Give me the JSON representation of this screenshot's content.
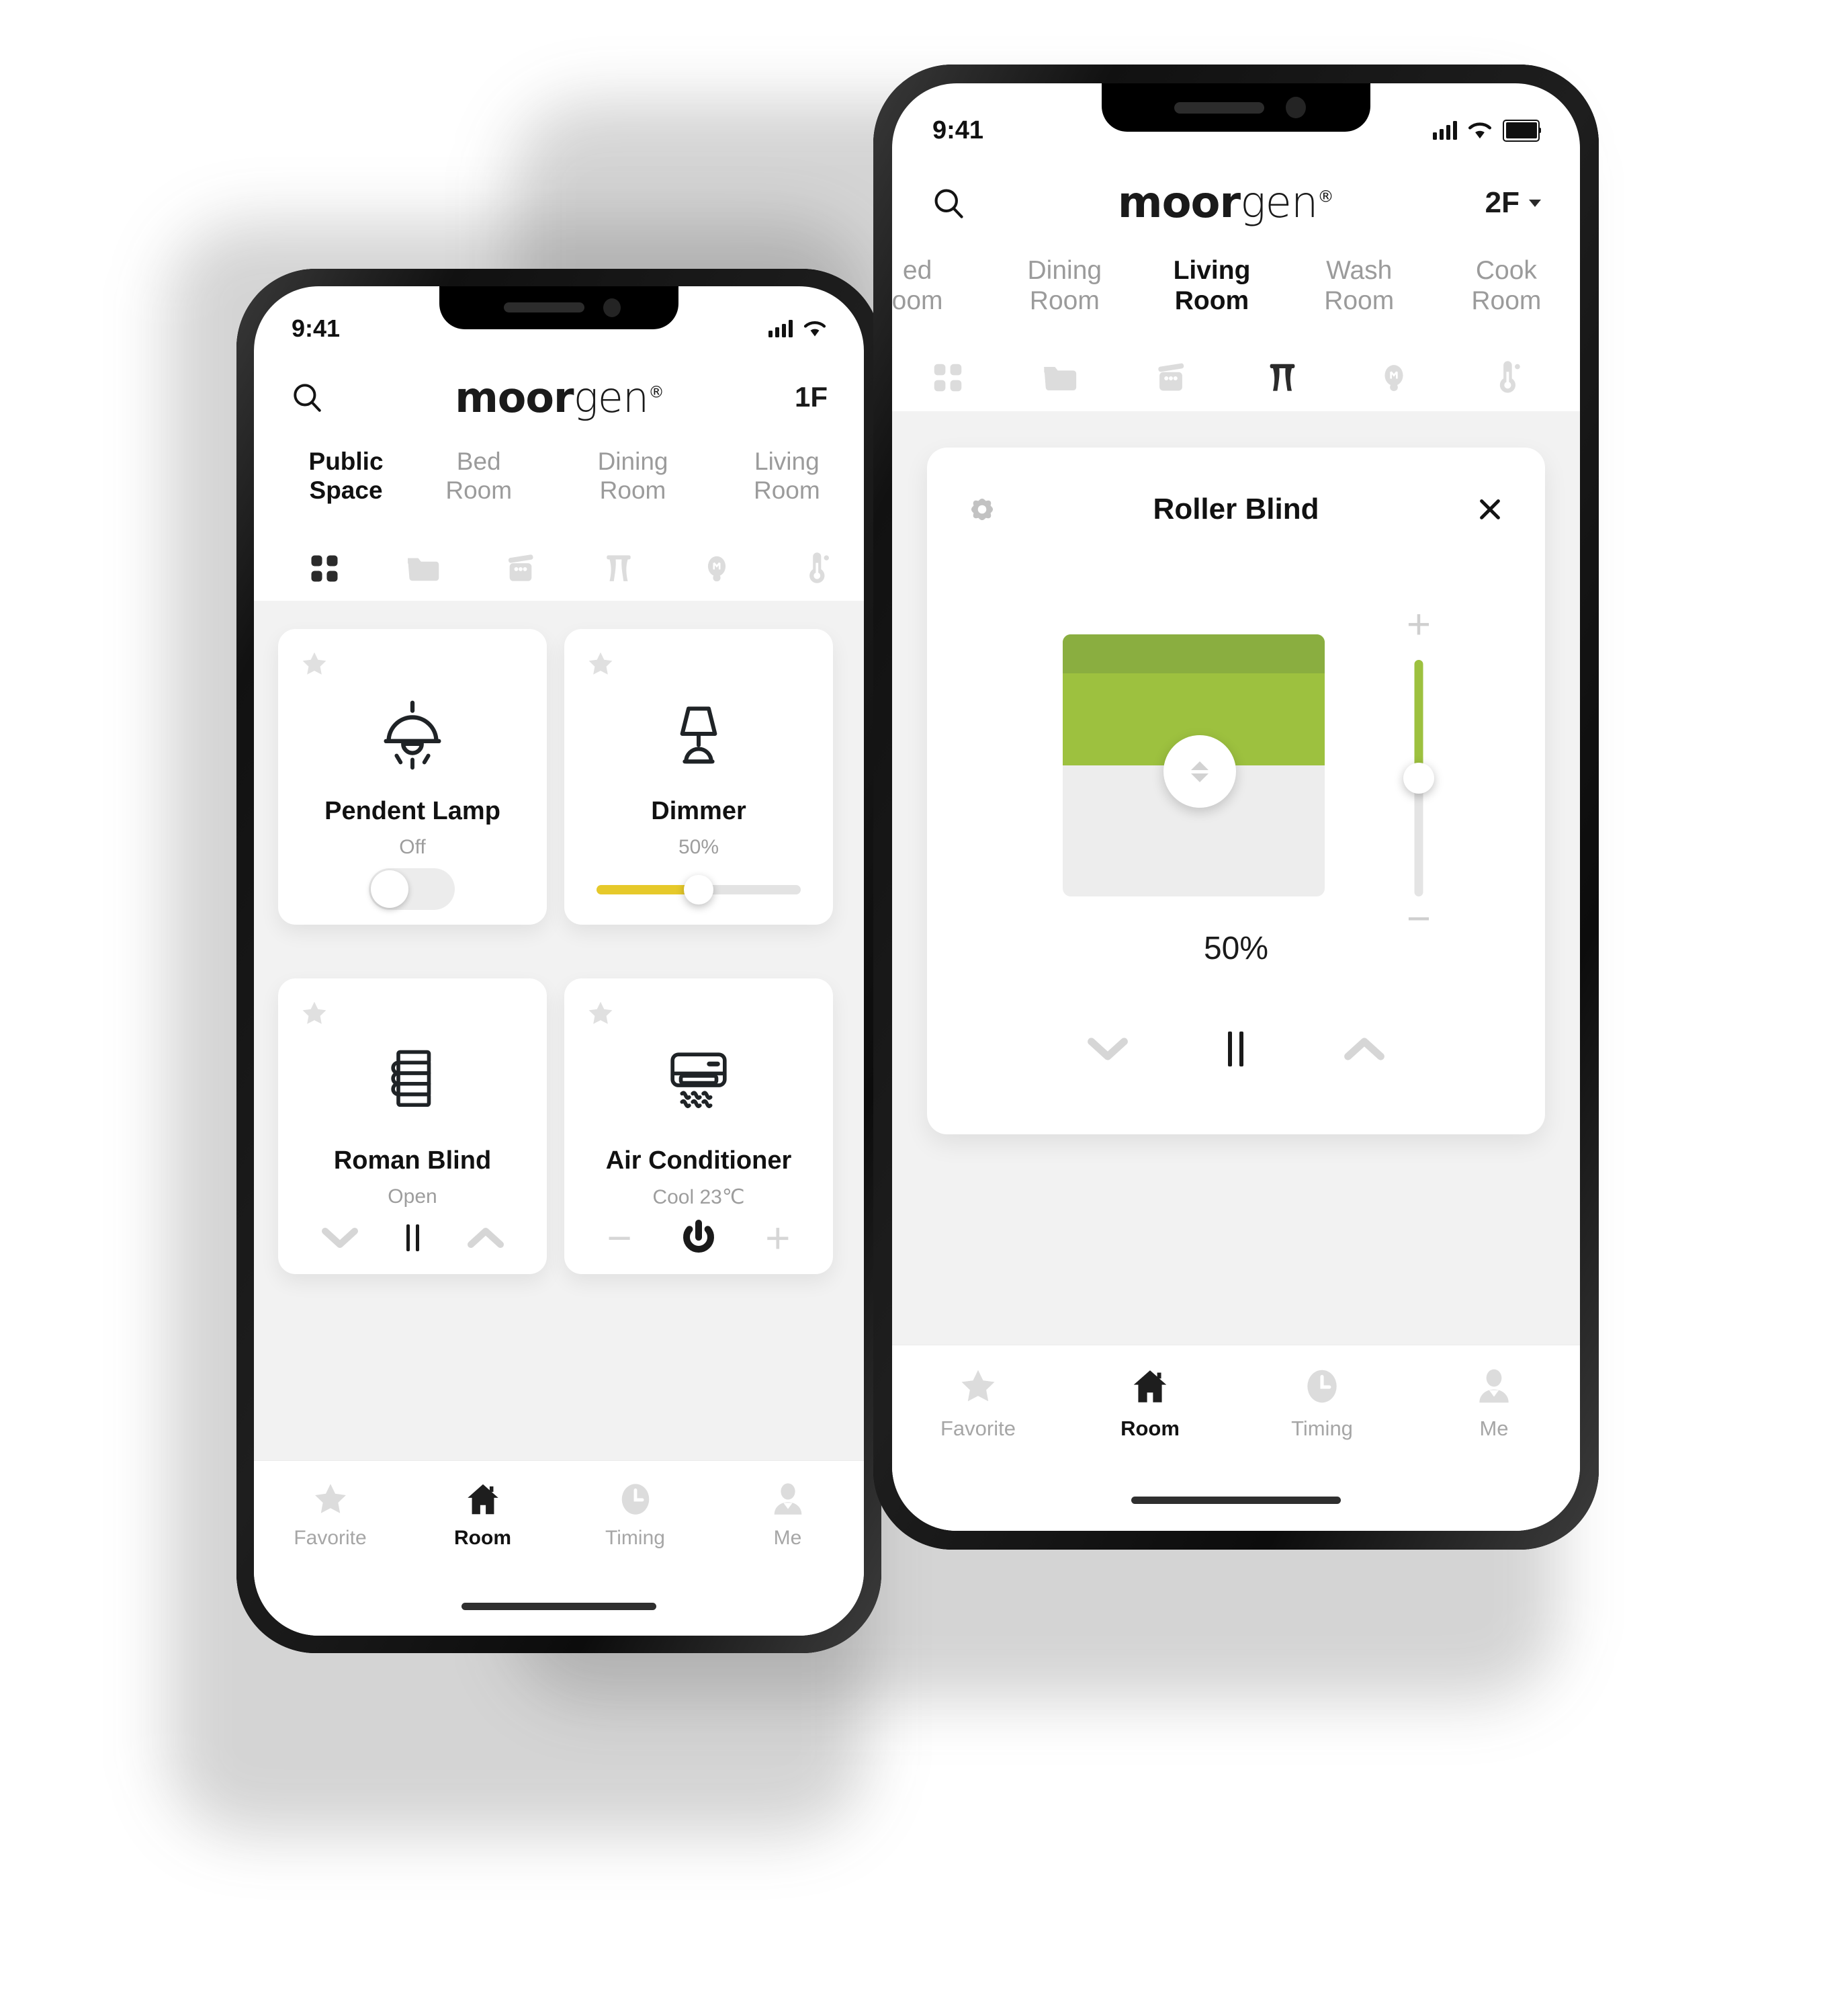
{
  "app": {
    "brand": "moorgen",
    "brand_light_part": "gen",
    "brand_bold_part": "moor",
    "registered_mark": "®",
    "accent_green": "#9dc13f",
    "accent_green_dark": "#8aae40",
    "accent_yellow": "#e6c92a"
  },
  "left_phone": {
    "status": {
      "time": "9:41",
      "signal_icon": "signal-bars-icon",
      "wifi_icon": "wifi-icon",
      "battery_icon": "battery-icon"
    },
    "header": {
      "search_icon": "search-icon",
      "floor": "1F",
      "floor_caret_icon": "chevron-down-icon"
    },
    "room_tabs": [
      {
        "label": "Public\nSpace",
        "active": true
      },
      {
        "label": "Bed\nRoom",
        "active": false
      },
      {
        "label": "Dining\nRoom",
        "active": false
      },
      {
        "label": "Living\nRoom",
        "active": false
      }
    ],
    "category_tabs": [
      {
        "icon": "grid-icon",
        "active": true
      },
      {
        "icon": "folder-icon",
        "active": false
      },
      {
        "icon": "appliance-icon",
        "active": false
      },
      {
        "icon": "curtain-icon",
        "active": false
      },
      {
        "icon": "bulb-icon",
        "active": false
      },
      {
        "icon": "thermometer-icon",
        "active": false
      }
    ],
    "devices": [
      {
        "name": "Pendent Lamp",
        "state": "Off",
        "icon": "pendant-lamp-icon",
        "control": "toggle",
        "toggle_on": false,
        "favorite_icon": "star-icon"
      },
      {
        "name": "Dimmer",
        "state": "50%",
        "icon": "table-lamp-icon",
        "control": "slider",
        "slider_value": 50,
        "favorite_icon": "star-icon"
      },
      {
        "name": "Roman Blind",
        "state": "Open",
        "icon": "roman-blind-icon",
        "control": "blind-buttons",
        "favorite_icon": "star-icon",
        "buttons": [
          "chevron-down-icon",
          "pause-icon",
          "chevron-up-icon"
        ]
      },
      {
        "name": "Air Conditioner",
        "state": "Cool 23℃",
        "icon": "air-conditioner-icon",
        "control": "ac-buttons",
        "favorite_icon": "star-icon",
        "buttons": [
          "minus-icon",
          "power-icon",
          "plus-icon"
        ]
      }
    ],
    "tabbar": [
      {
        "label": "Favorite",
        "icon": "star-icon",
        "active": false
      },
      {
        "label": "Room",
        "icon": "home-icon",
        "active": true
      },
      {
        "label": "Timing",
        "icon": "clock-icon",
        "active": false
      },
      {
        "label": "Me",
        "icon": "person-icon",
        "active": false
      }
    ]
  },
  "right_phone": {
    "status": {
      "time": "9:41",
      "signal_icon": "signal-bars-icon",
      "wifi_icon": "wifi-icon",
      "battery_icon": "battery-icon"
    },
    "header": {
      "search_icon": "search-icon",
      "floor": "2F",
      "floor_caret_icon": "chevron-down-icon"
    },
    "room_tabs": [
      {
        "label": "ed\noom",
        "active": false
      },
      {
        "label": "Dining\nRoom",
        "active": false
      },
      {
        "label": "Living\nRoom",
        "active": true
      },
      {
        "label": "Wash\nRoom",
        "active": false
      },
      {
        "label": "Cook\nRoom",
        "active": false
      }
    ],
    "category_tabs": [
      {
        "icon": "grid-icon",
        "active": false
      },
      {
        "icon": "folder-icon",
        "active": false
      },
      {
        "icon": "appliance-icon",
        "active": false
      },
      {
        "icon": "curtain-icon",
        "active": true
      },
      {
        "icon": "bulb-icon",
        "active": false
      },
      {
        "icon": "thermometer-icon",
        "active": false
      }
    ],
    "roller_blind": {
      "settings_icon": "gear-icon",
      "title": "Roller Blind",
      "close_icon": "close-icon",
      "percent_label": "50%",
      "position_percent": 50,
      "slider_value": 50,
      "increase_icon": "plus-icon",
      "decrease_icon": "minus-icon",
      "grip_icon": "up-down-arrows-icon",
      "buttons": [
        "chevron-down-icon",
        "pause-icon",
        "chevron-up-icon"
      ]
    },
    "tabbar": [
      {
        "label": "Favorite",
        "icon": "star-icon",
        "active": false
      },
      {
        "label": "Room",
        "icon": "home-icon",
        "active": true
      },
      {
        "label": "Timing",
        "icon": "clock-icon",
        "active": false
      },
      {
        "label": "Me",
        "icon": "person-icon",
        "active": false
      }
    ]
  }
}
